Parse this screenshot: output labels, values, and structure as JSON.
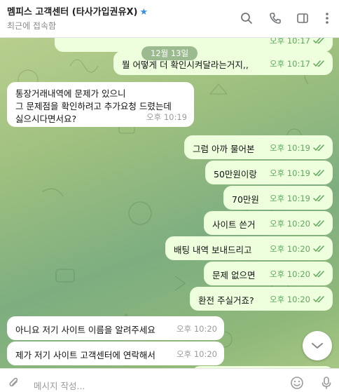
{
  "header": {
    "title": "멤피스 고객센터 (타사가입권유X)",
    "status": "최근에 접속함",
    "icons": [
      "verified-star-icon",
      "search-icon",
      "phone-icon",
      "sidebar-toggle-icon",
      "more-vertical-icon"
    ]
  },
  "chat": {
    "date_label": "12월 13일",
    "messages": [
      {
        "dir": "out",
        "text": "",
        "time": "오후 10:17"
      },
      {
        "dir": "out",
        "text": "뭘 어떻게 더 확인시켜달라는거지,,",
        "time": "오후 10:17"
      },
      {
        "dir": "in",
        "lines": [
          "통장거래내역에 문제가 있으니",
          "그 문제점을 확인하려고 추가요청 드렸는데",
          "싫으시다면서요?"
        ],
        "time": "오후 10:19"
      },
      {
        "dir": "out",
        "text": "그럼 아까 물어본",
        "time": "오후 10:19"
      },
      {
        "dir": "out",
        "text": "50만원이랑",
        "time": "오후 10:19"
      },
      {
        "dir": "out",
        "text": "70만원",
        "time": "오후 10:19"
      },
      {
        "dir": "out",
        "text": "사이트 쓴거",
        "time": "오후 10:20"
      },
      {
        "dir": "out",
        "text": "배팅 내역 보내드리고",
        "time": "오후 10:20"
      },
      {
        "dir": "out",
        "text": "문제 없으면",
        "time": "오후 10:20"
      },
      {
        "dir": "out",
        "text": "환전 주실거죠?",
        "time": "오후 10:20"
      },
      {
        "dir": "in",
        "text": "아니요 저기 사이트 이름을 알려주세요",
        "time": "오후 10:20"
      },
      {
        "dir": "in",
        "text": "제가 저기 사이트 고객센터에 연락해서",
        "time": "오후 10:20"
      }
    ]
  },
  "composer": {
    "placeholder": "메시지 작성...",
    "icons": [
      "attach-icon",
      "emoji-icon",
      "microphone-icon"
    ]
  },
  "colors": {
    "outgoing_bubble": "#eeffde",
    "incoming_bubble": "#ffffff",
    "check_green": "#5ea85c",
    "verified_blue": "#3a8ee6"
  }
}
